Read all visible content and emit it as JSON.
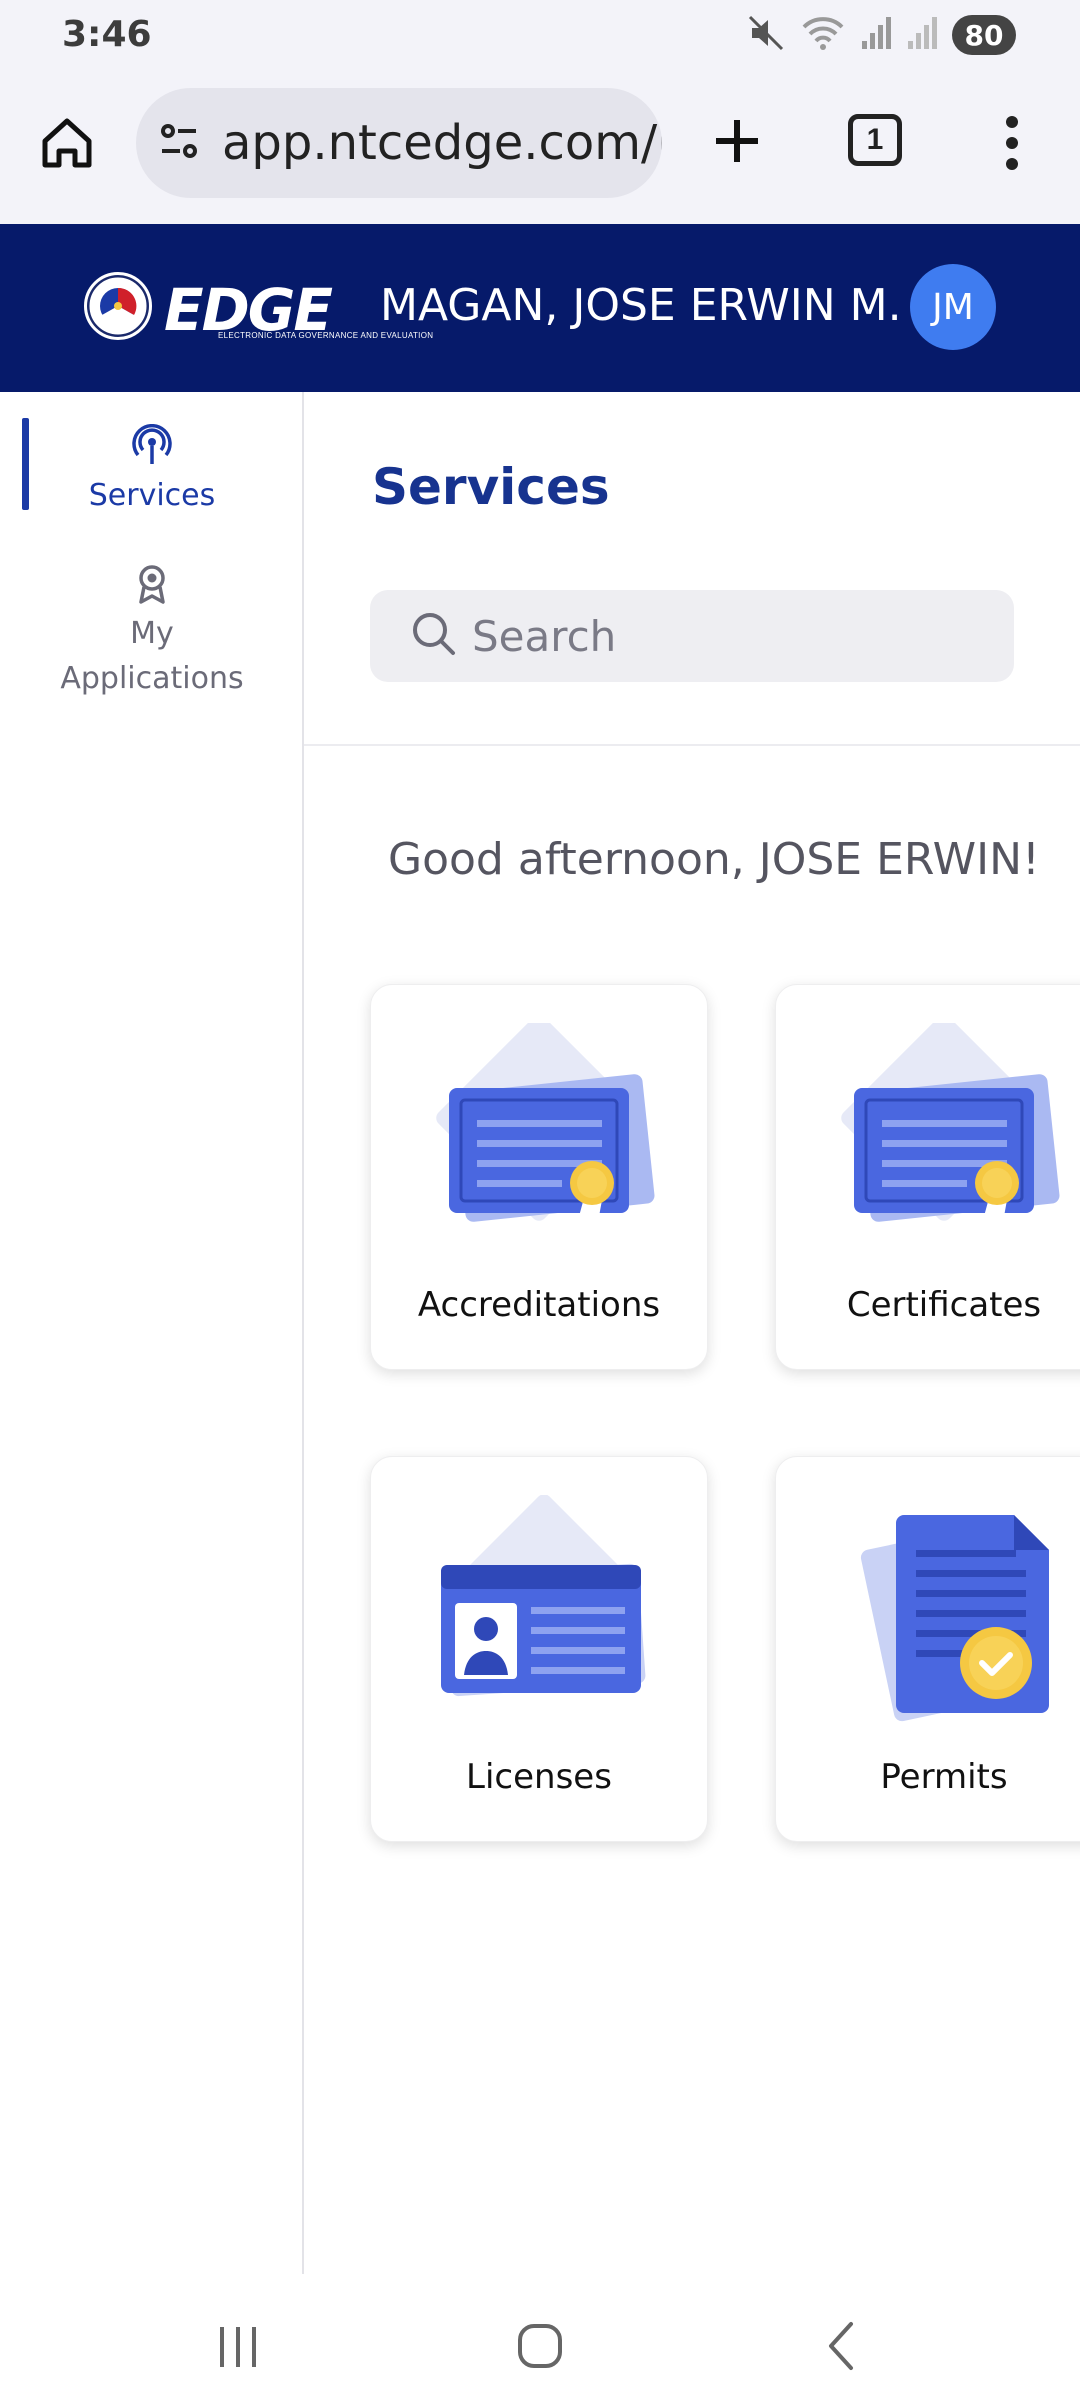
{
  "status_bar": {
    "time": "3:46",
    "battery": "80",
    "icons": [
      "mute-icon",
      "wifi-icon",
      "signal-icon",
      "signal-icon"
    ]
  },
  "browser": {
    "url": "app.ntcedge.com/l",
    "tab_count": "1"
  },
  "header": {
    "logo_text": "EDGE",
    "logo_subtitle": "ELECTRONIC DATA GOVERNANCE AND EVALUATION",
    "user_name": "MAGAN, JOSE ERWIN M.",
    "avatar_initials": "JM"
  },
  "sidebar": {
    "items": [
      {
        "label": "Services",
        "icon": "antenna-icon",
        "active": true
      },
      {
        "label": "My Applications",
        "icon": "award-icon",
        "active": false
      }
    ]
  },
  "main": {
    "title": "Services",
    "search_placeholder": "Search",
    "greeting": "Good afternoon, JOSE ERWIN!",
    "cards": [
      {
        "label": "Accreditations",
        "icon": "certificate-icon"
      },
      {
        "label": "Certificates",
        "icon": "certificate-icon"
      },
      {
        "label": "Licenses",
        "icon": "id-card-icon"
      },
      {
        "label": "Permits",
        "icon": "document-check-icon"
      }
    ]
  },
  "colors": {
    "header_bg": "#061a6a",
    "accent": "#1b3aa6",
    "avatar_bg": "#3f7cf0",
    "illustration_blue": "#4a67e0",
    "badge_gold": "#f5c842"
  }
}
